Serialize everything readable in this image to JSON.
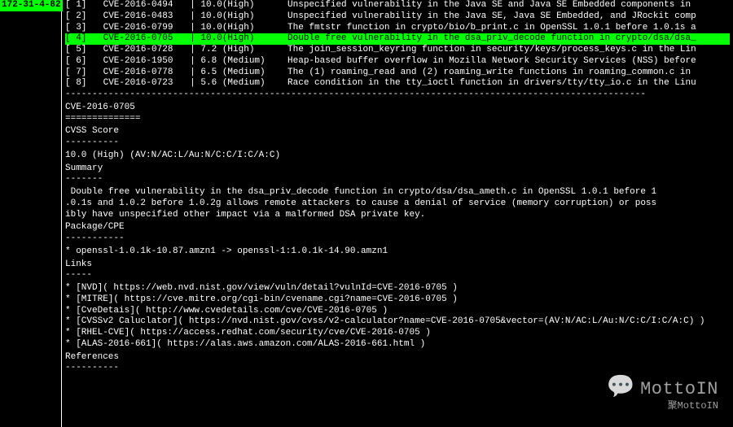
{
  "host": "172-31-4-82",
  "rows": [
    {
      "idx": "[ 1]",
      "cve": "CVE-2016-0494",
      "score": "10.0(High)",
      "desc": "Unspecified vulnerability in the Java SE and Java SE Embedded components in",
      "sel": false
    },
    {
      "idx": "[ 2]",
      "cve": "CVE-2016-0483",
      "score": "10.0(High)",
      "desc": "Unspecified vulnerability in the Java SE, Java SE Embedded, and JRockit comp",
      "sel": false
    },
    {
      "idx": "[ 3]",
      "cve": "CVE-2016-0799",
      "score": "10.0(High)",
      "desc": "The fmtstr function in crypto/bio/b_print.c in OpenSSL 1.0.1 before 1.0.1s a",
      "sel": false
    },
    {
      "idx": "[ 4]",
      "cve": "CVE-2016-0705",
      "score": "10.0(High)",
      "desc": "Double free vulnerability in the dsa_priv_decode function in crypto/dsa/dsa_",
      "sel": true
    },
    {
      "idx": "[ 5]",
      "cve": "CVE-2016-0728",
      "score": "7.2 (High)",
      "desc": "The join_session_keyring function in security/keys/process_keys.c in the Lin",
      "sel": false
    },
    {
      "idx": "[ 6]",
      "cve": "CVE-2016-1950",
      "score": "6.8 (Medium)",
      "desc": "Heap-based buffer overflow in Mozilla Network Security Services (NSS) before",
      "sel": false
    },
    {
      "idx": "[ 7]",
      "cve": "CVE-2016-0778",
      "score": "6.5 (Medium)",
      "desc": "The (1) roaming_read and (2) roaming_write functions in roaming_common.c in",
      "sel": false
    },
    {
      "idx": "[ 8]",
      "cve": "CVE-2016-0723",
      "score": "5.6 (Medium)",
      "desc": "Race condition in the tty_ioctl function in drivers/tty/tty_io.c in the Linu",
      "sel": false
    }
  ],
  "divider": "------------------------------------------------------------------------------------------------------------",
  "detail": {
    "cve_title": "CVE-2016-0705",
    "under1": "==============",
    "cvss_label": "CVSS Score",
    "under2": "----------",
    "cvss_value": "10.0 (High) (AV:N/AC:L/Au:N/C:C/I:C/A:C)",
    "summary_label": "Summary",
    "under3": "-------",
    "summary_body": " Double free vulnerability in the dsa_priv_decode function in crypto/dsa/dsa_ameth.c in OpenSSL 1.0.1 before 1\n.0.1s and 1.0.2 before 1.0.2g allows remote attackers to cause a denial of service (memory corruption) or poss\nibly have unspecified other impact via a malformed DSA private key.",
    "package_label": "Package/CPE",
    "under4": "-----------",
    "package_value": "* openssl-1.0.1k-10.87.amzn1 -> openssl-1:1.0.1k-14.90.amzn1",
    "links_label": "Links",
    "under5": "-----",
    "links": [
      "* [NVD]( https://web.nvd.nist.gov/view/vuln/detail?vulnId=CVE-2016-0705 )",
      "* [MITRE]( https://cve.mitre.org/cgi-bin/cvename.cgi?name=CVE-2016-0705 )",
      "* [CveDetais]( http://www.cvedetails.com/cve/CVE-2016-0705 )",
      "* [CVSSv2 Caluclator]( https://nvd.nist.gov/cvss/v2-calculator?name=CVE-2016-0705&vector=(AV:N/AC:L/Au:N/C:C/I:C/A:C) )",
      "* [RHEL-CVE]( https://access.redhat.com/security/cve/CVE-2016-0705 )",
      "* [ALAS-2016-661]( https://alas.aws.amazon.com/ALAS-2016-661.html )"
    ],
    "ref_label": "References",
    "under6": "----------"
  },
  "watermark": {
    "brand": "MottoIN",
    "sub": "聚MottoIN"
  }
}
